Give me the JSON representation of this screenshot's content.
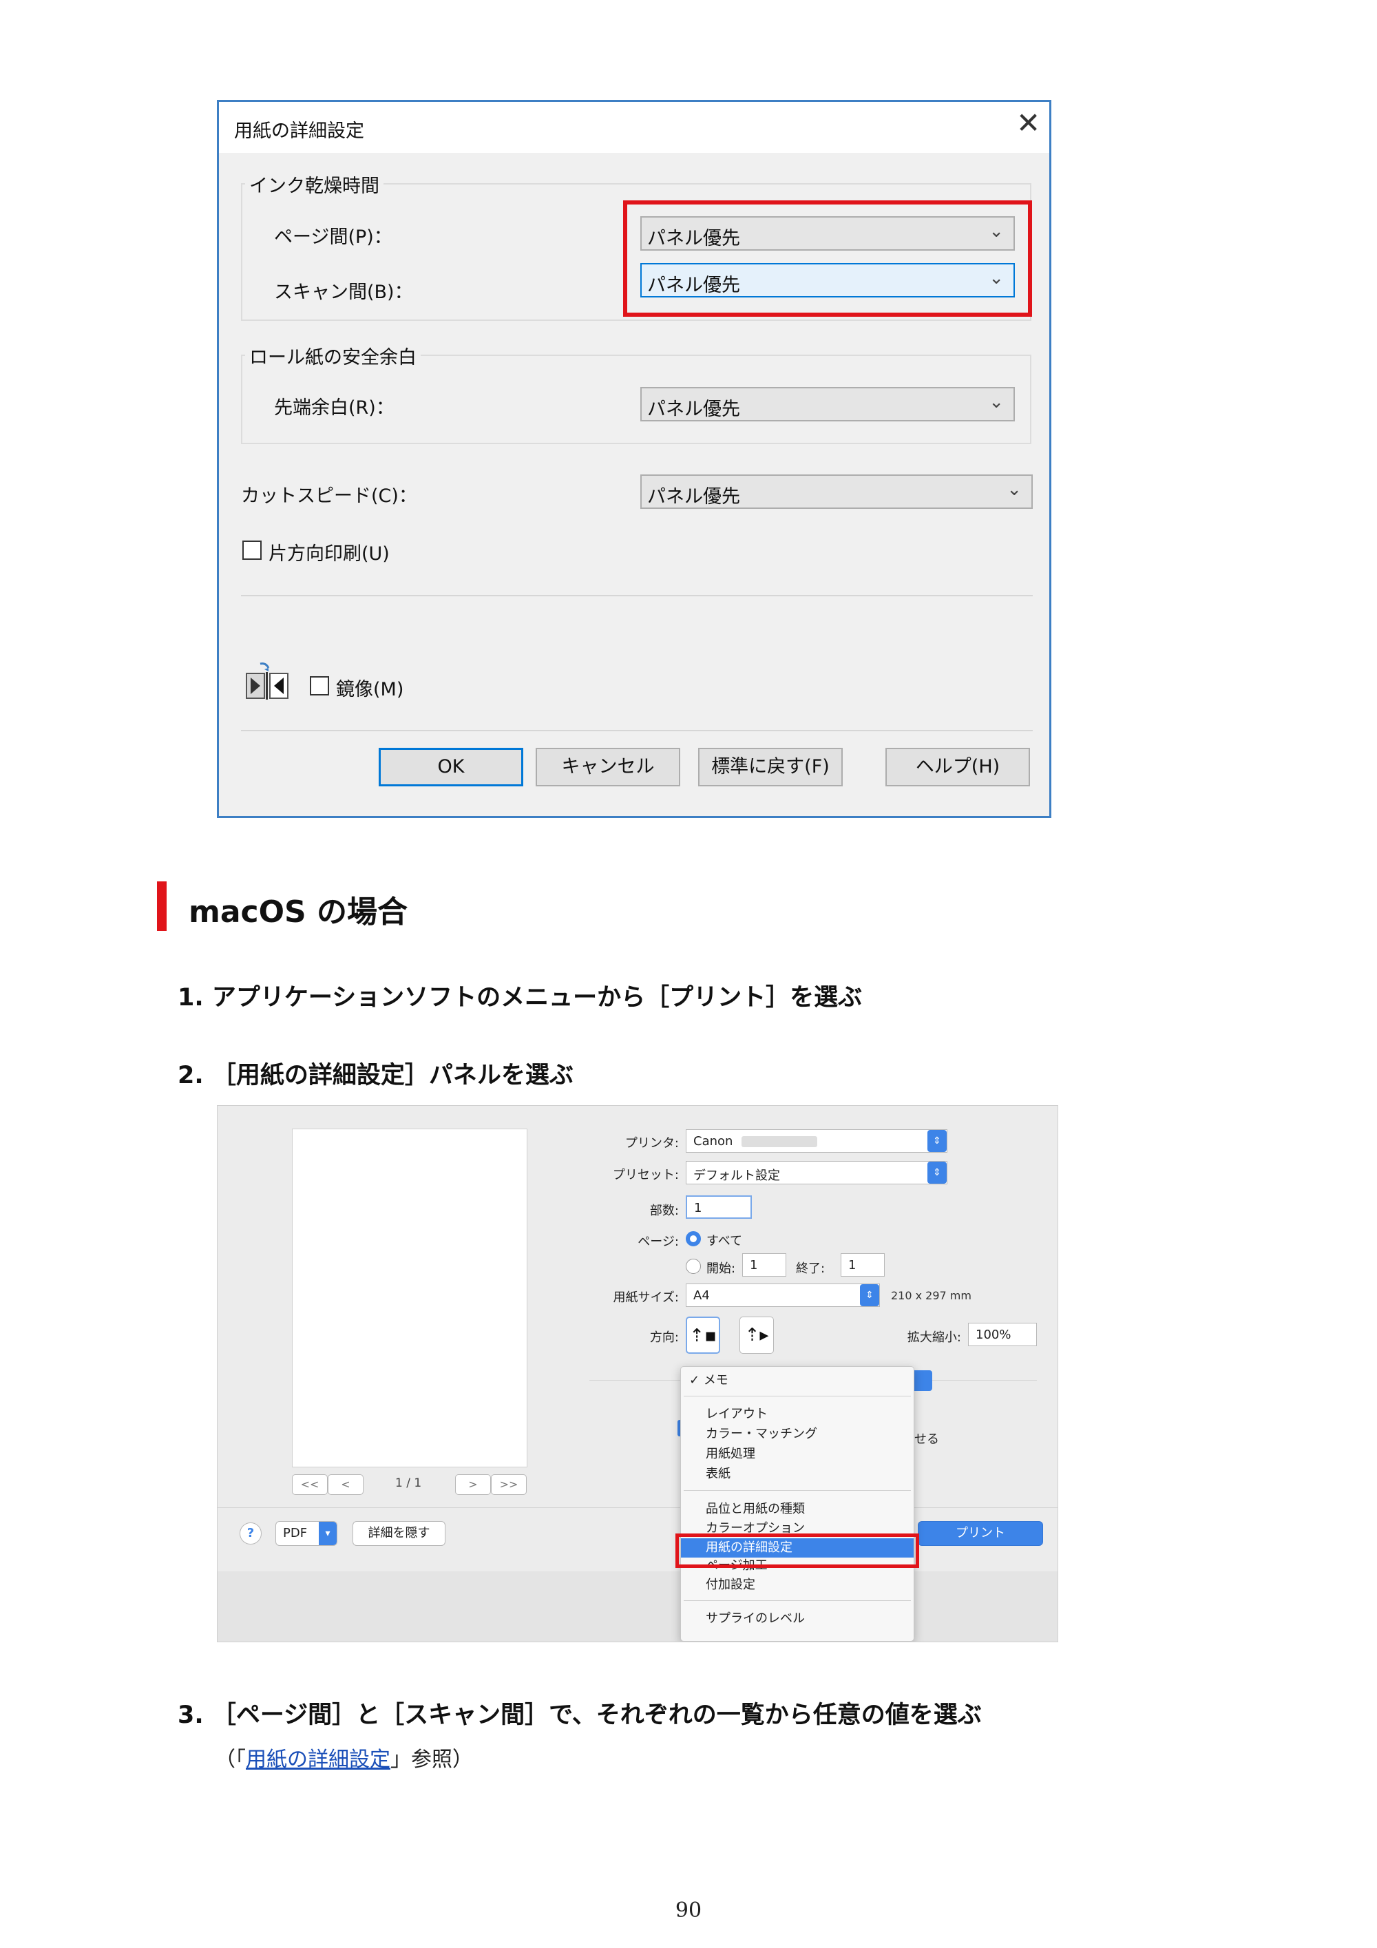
{
  "windows_dialog": {
    "title": "用紙の詳細設定",
    "ink_dry_group": "インク乾燥時間",
    "page_interval_label": "ページ間(P)：",
    "page_interval_value": "パネル優先",
    "scan_interval_label": "スキャン間(B)：",
    "scan_interval_value": "パネル優先",
    "roll_margin_group": "ロール紙の安全余白",
    "leading_margin_label": "先端余白(R)：",
    "leading_margin_value": "パネル優先",
    "cut_speed_label": "カットスピード(C)：",
    "cut_speed_value": "パネル優先",
    "unidirectional_label": "片方向印刷(U)",
    "mirror_label": "鏡像(M)",
    "ok_label": "OK",
    "cancel_label": "キャンセル",
    "defaults_label": "標準に戻す(F)",
    "help_label": "ヘルプ(H)"
  },
  "section": {
    "title": "macOS の場合"
  },
  "steps": {
    "step1": "1. アプリケーションソフトのメニューから［プリント］を選ぶ",
    "step2": "2. ［用紙の詳細設定］パネルを選ぶ",
    "step3": "3. ［ページ間］と［スキャン間］で、それぞれの一覧から任意の値を選ぶ",
    "note_prefix": "（「",
    "note_link": "用紙の詳細設定",
    "note_suffix": "」参照）"
  },
  "mac_dialog": {
    "printer_label": "プリンタ:",
    "printer_value": "Canon",
    "preset_label": "プリセット:",
    "preset_value": "デフォルト設定",
    "copies_label": "部数:",
    "copies_value": "1",
    "pages_label": "ページ:",
    "pages_all": "すべて",
    "pages_from_label": "開始:",
    "pages_from_value": "1",
    "pages_to_label": "終了:",
    "pages_to_value": "1",
    "paper_size_label": "用紙サイズ:",
    "paper_size_value": "A4",
    "paper_size_dims": "210 x 297 mm",
    "orientation_label": "方向:",
    "scale_label": "拡大縮小:",
    "scale_value": "100%",
    "page_counter": "1 / 1",
    "nav_first": "<<",
    "nav_prev": "<",
    "nav_next": ">",
    "nav_last": ">>",
    "help_label": "?",
    "pdf_label": "PDF",
    "hide_details_label": "詳細を隠す",
    "print_label": "プリント",
    "partial_text": "せる",
    "menu": {
      "memo": "メモ",
      "layout": "レイアウト",
      "color_matching": "カラー・マッチング",
      "paper_handling": "用紙処理",
      "cover": "表紙",
      "quality_media": "品位と用紙の種類",
      "color_options": "カラーオプション",
      "paper_detail": "用紙の詳細設定",
      "page_processing": "ページ加工",
      "additional": "付加設定",
      "supply_levels": "サプライのレベル"
    }
  },
  "page_number": "90",
  "colors": {
    "highlight_red": "#e0141a",
    "mac_blue": "#3d84e8",
    "win_blue": "#0078d7"
  }
}
